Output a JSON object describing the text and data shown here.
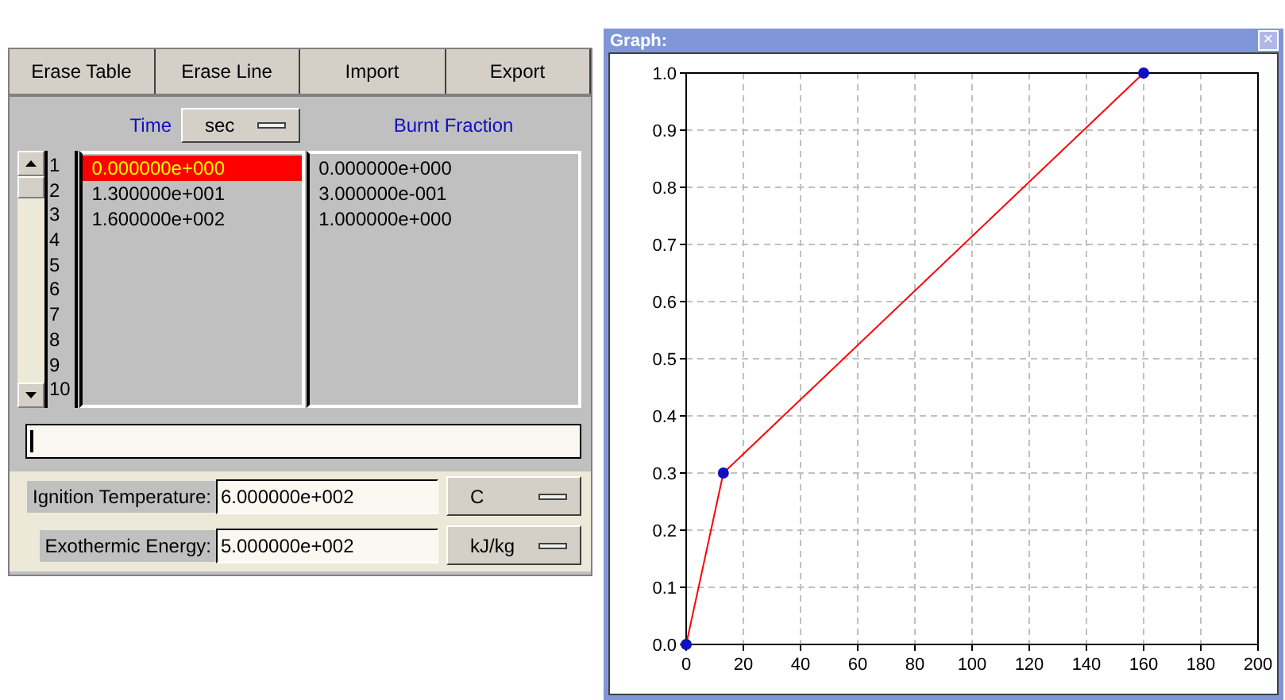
{
  "toolbar": {
    "buttons": [
      "Erase Table",
      "Erase Line",
      "Import",
      "Export"
    ]
  },
  "table": {
    "time_header": "Time",
    "time_unit": "sec",
    "fraction_header": "Burnt Fraction",
    "row_numbers": [
      "1",
      "2",
      "3",
      "4",
      "5",
      "6",
      "7",
      "8",
      "9",
      "10"
    ],
    "rows": [
      {
        "time": "0.000000e+000",
        "fraction": "0.000000e+000",
        "selected": true
      },
      {
        "time": "1.300000e+001",
        "fraction": "3.000000e-001",
        "selected": false
      },
      {
        "time": "1.600000e+002",
        "fraction": "1.000000e+000",
        "selected": false
      }
    ]
  },
  "fields": [
    {
      "label": "Ignition Temperature:",
      "value": "6.000000e+002",
      "unit": "C"
    },
    {
      "label": "Exothermic Energy:",
      "value": "5.000000e+002",
      "unit": "kJ/kg"
    }
  ],
  "graph": {
    "title": "Graph:",
    "close": "×",
    "chart_data": {
      "type": "line",
      "x": [
        0,
        13,
        160
      ],
      "series": [
        {
          "color": "#ff0000",
          "marker": "o",
          "values": [
            0,
            0.3,
            1.0
          ]
        }
      ],
      "grid": true,
      "xlim": [
        0,
        200
      ],
      "ylim": [
        0,
        1
      ],
      "xticks": [
        0,
        20,
        40,
        60,
        80,
        100,
        120,
        140,
        160,
        180,
        200
      ],
      "yticks": [
        {
          "value": 0,
          "label": "0.0"
        },
        {
          "value": 0.1,
          "label": "0.1"
        },
        {
          "value": 0.2,
          "label": "0.2"
        },
        {
          "value": 0.3,
          "label": "0.3"
        },
        {
          "value": 0.4,
          "label": "0.4"
        },
        {
          "value": 0.5,
          "label": "0.5"
        },
        {
          "value": 0.6,
          "label": "0.6"
        },
        {
          "value": 0.7,
          "label": "0.7"
        },
        {
          "value": 0.8,
          "label": "0.8"
        },
        {
          "value": 0.9,
          "label": "0.9"
        },
        {
          "value": 1,
          "label": "1.0"
        }
      ]
    }
  }
}
